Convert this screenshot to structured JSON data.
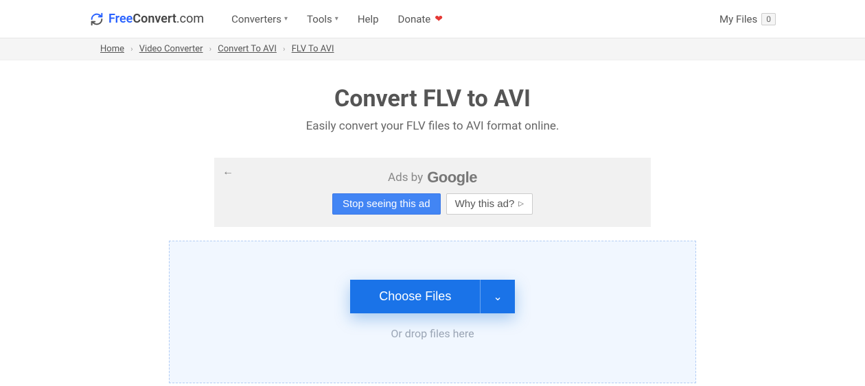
{
  "brand": {
    "free": "Free",
    "convert": "Convert",
    "dotcom": ".com"
  },
  "nav": {
    "converters": "Converters",
    "tools": "Tools",
    "help": "Help",
    "donate": "Donate",
    "myfiles_label": "My Files",
    "myfiles_count": "0"
  },
  "breadcrumb": {
    "home": "Home",
    "video_converter": "Video Converter",
    "convert_to_avi": "Convert To AVI",
    "flv_to_avi": "FLV To AVI"
  },
  "page": {
    "title": "Convert FLV to AVI",
    "subtitle": "Easily convert your FLV files to AVI format online."
  },
  "ad": {
    "ads_by": "Ads by",
    "google": "Google",
    "stop": "Stop seeing this ad",
    "why": "Why this ad?"
  },
  "dropzone": {
    "choose": "Choose Files",
    "hint": "Or drop files here"
  }
}
